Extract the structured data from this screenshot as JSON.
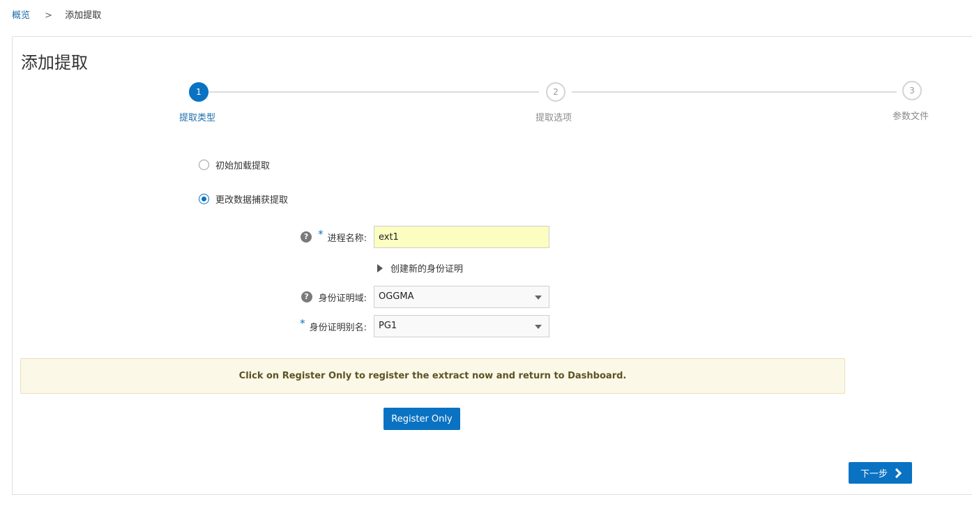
{
  "breadcrumb": {
    "home": "概览",
    "separator": ">",
    "current": "添加提取"
  },
  "page": {
    "title": "添加提取"
  },
  "stepper": {
    "steps": [
      {
        "number": "1",
        "label": "提取类型",
        "state": "active"
      },
      {
        "number": "2",
        "label": "提取选项",
        "state": "inactive"
      },
      {
        "number": "3",
        "label": "参数文件",
        "state": "inactive"
      }
    ]
  },
  "extract_type": {
    "options": [
      {
        "label": "初始加载提取",
        "checked": false
      },
      {
        "label": "更改数据捕获提取",
        "checked": true
      }
    ]
  },
  "form": {
    "process_name": {
      "label": "进程名称:",
      "value": "ext1",
      "required": true,
      "has_help": true
    },
    "create_credential": {
      "label": "创建新的身份证明"
    },
    "credential_domain": {
      "label": "身份证明域:",
      "value": "OGGMA",
      "required": false,
      "has_help": true
    },
    "credential_alias": {
      "label": "身份证明别名:",
      "value": "PG1",
      "required": true,
      "has_help": false
    },
    "help_glyph": "?",
    "required_mark": "*"
  },
  "info_message": "Click on Register Only to register the extract now and return to Dashboard.",
  "buttons": {
    "register_only": "Register Only",
    "next": "下一步"
  },
  "colors": {
    "accent": "#0a72c2",
    "link": "#1d6ea8",
    "input_highlight": "#fbfdc1",
    "info_bg": "#fbf8e7",
    "info_border": "#eadfb8"
  }
}
